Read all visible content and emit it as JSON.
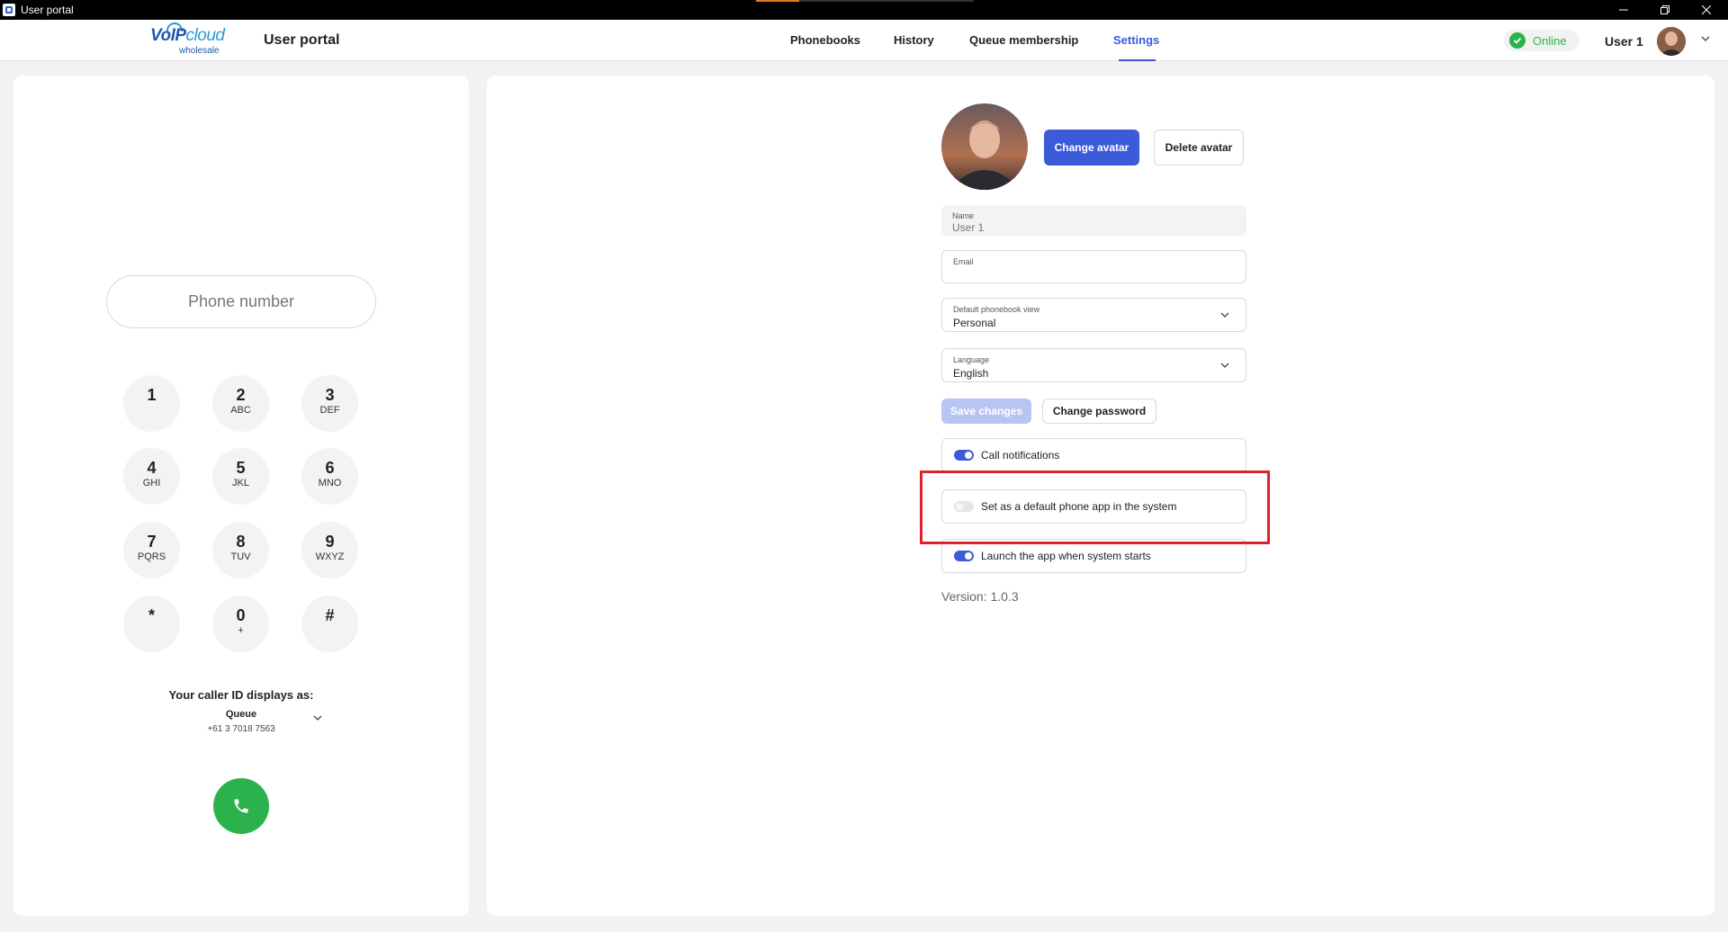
{
  "window": {
    "title": "User portal"
  },
  "header": {
    "logo_main": "VoIP",
    "logo_cloud": "cloud",
    "logo_sub": "wholesale",
    "portal_title": "User portal",
    "nav": [
      {
        "label": "Phonebooks"
      },
      {
        "label": "History"
      },
      {
        "label": "Queue membership"
      },
      {
        "label": "Settings"
      }
    ],
    "active_nav": "Settings",
    "status": "Online",
    "user_name": "User 1"
  },
  "dialer": {
    "phone_placeholder": "Phone number",
    "keys": [
      {
        "digit": "1",
        "sub": ""
      },
      {
        "digit": "2",
        "sub": "ABC"
      },
      {
        "digit": "3",
        "sub": "DEF"
      },
      {
        "digit": "4",
        "sub": "GHI"
      },
      {
        "digit": "5",
        "sub": "JKL"
      },
      {
        "digit": "6",
        "sub": "MNO"
      },
      {
        "digit": "7",
        "sub": "PQRS"
      },
      {
        "digit": "8",
        "sub": "TUV"
      },
      {
        "digit": "9",
        "sub": "WXYZ"
      },
      {
        "digit": "*",
        "sub": ""
      },
      {
        "digit": "0",
        "sub": "+"
      },
      {
        "digit": "#",
        "sub": ""
      }
    ],
    "caller_id_label": "Your caller ID displays as:",
    "caller_id_name": "Queue",
    "caller_id_number": "+61 3 7018 7563"
  },
  "settings": {
    "change_avatar": "Change avatar",
    "delete_avatar": "Delete avatar",
    "name_label": "Name",
    "name_value": "User 1",
    "email_label": "Email",
    "email_value": "",
    "phonebook_label": "Default phonebook view",
    "phonebook_value": "Personal",
    "language_label": "Language",
    "language_value": "English",
    "save_changes": "Save changes",
    "change_password": "Change password",
    "toggles": [
      {
        "label": "Call notifications",
        "on": true
      },
      {
        "label": "Set as a default phone app in the system",
        "on": false
      },
      {
        "label": "Launch the app when system starts",
        "on": true
      }
    ],
    "version": "Version: 1.0.3"
  },
  "colors": {
    "accent": "#3b5bdb",
    "online": "#2bb24c",
    "highlight": "#e0202c"
  }
}
